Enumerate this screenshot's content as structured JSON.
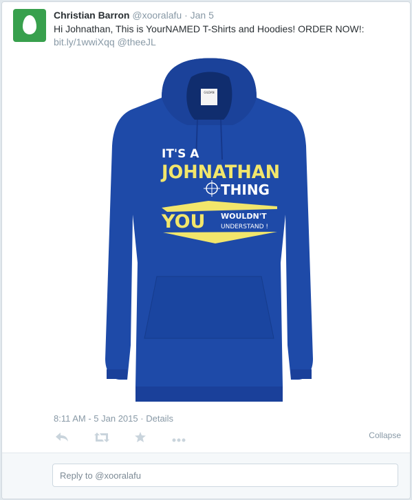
{
  "tweet": {
    "author_name": "Christian Barron",
    "handle": "@xooralafu",
    "date": "Jan 5",
    "separator": "·",
    "text_line1": "Hi Johnathan, This is YourNAMED T-Shirts and Hoodies! ORDER NOW!:",
    "link": "bit.ly/1wwiXqq",
    "mention": "@theeJL",
    "timestamp": "8:11 AM - 5 Jan 2015",
    "details_label": "Details",
    "collapse_label": "Collapse",
    "reply_placeholder": "Reply to @xooralafu"
  },
  "hoodie": {
    "brand_tag": "GILDAN",
    "line_its_a": "IT'S A",
    "line_name": "JOHNATHAN",
    "line_thing": "THING",
    "line_you": "YOU",
    "line_wouldnt": "WOULDN'T",
    "line_understand": "UNDERSTAND !",
    "colors": {
      "hoodie": "#1e4aa8",
      "print": "#f2e66b"
    }
  },
  "icons": [
    "reply-icon",
    "retweet-icon",
    "favorite-icon",
    "more-icon"
  ]
}
